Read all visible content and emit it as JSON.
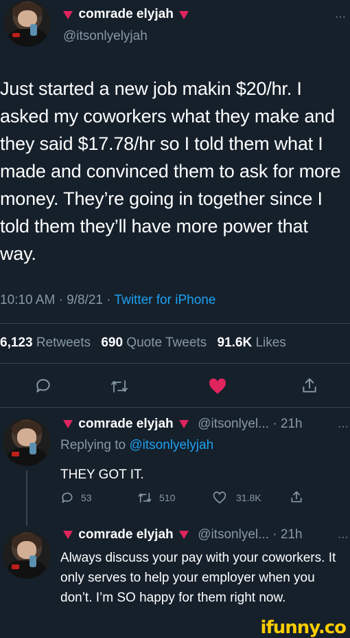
{
  "main_tweet": {
    "display_name": "comrade elyjah",
    "handle": "@itsonlyelyjah",
    "more": "···",
    "text": "Just started a new job makin $20/hr. I asked my coworkers what they make and they said $17.78/hr so I told them what I made and convinced them to ask for more money. They’re going in together since I told them they’ll have more power that way.",
    "time": "10:10 AM",
    "sep1": " · ",
    "date": "9/8/21",
    "sep2": " · ",
    "source": "Twitter for iPhone",
    "retweets": "6,123",
    "retweets_label": " Retweets",
    "quotes": "690",
    "quotes_label": " Quote Tweets",
    "likes": "91.6K",
    "likes_label": " Likes"
  },
  "reply1": {
    "display_name": "comrade elyjah",
    "handle_time": "@itsonlyel... · 21h",
    "more": "···",
    "replying_prefix": "Replying to ",
    "replying_handle": "@itsonlyelyjah",
    "text": "THEY GOT IT.",
    "replies": "53",
    "retweets": "510",
    "likes": "31.8K"
  },
  "reply2": {
    "display_name": "comrade elyjah",
    "handle_time": "@itsonlyel... · 21h",
    "more": "···",
    "text": "Always discuss your pay with your coworkers. It only serves to help your employer when you don’t. I’m SO happy for them right now."
  },
  "watermark": "ifunny.co",
  "colors": {
    "background": "#15202b",
    "accent_blue": "#1da1f2",
    "like_red": "#e0245e",
    "muted": "#8899a6"
  }
}
